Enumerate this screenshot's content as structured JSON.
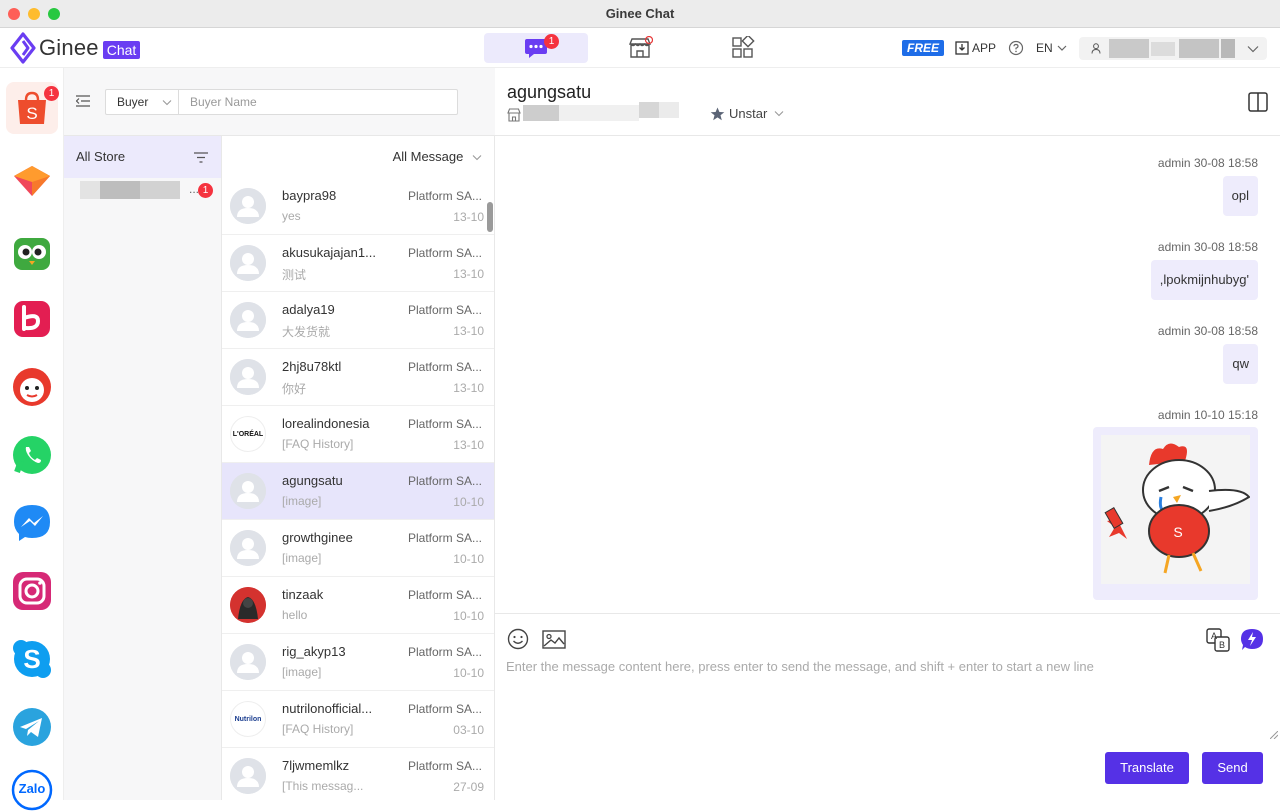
{
  "window": {
    "title": "Ginee Chat"
  },
  "brand": {
    "name": "Ginee",
    "badge": "Chat",
    "accent": "#6a3df2"
  },
  "header": {
    "chat_tab_badge": "1",
    "free_label": "FREE",
    "app_label": "APP",
    "lang_label": "EN"
  },
  "sidebar": {
    "apps": [
      {
        "name": "shopee",
        "badge": "1",
        "color": "#ee4d2d"
      },
      {
        "name": "lazada",
        "color": "#f0475b"
      },
      {
        "name": "tokopedia",
        "color": "#3fa93f"
      },
      {
        "name": "bukalapak",
        "color": "#e31e52"
      },
      {
        "name": "bot",
        "color": "#e8392c"
      },
      {
        "name": "whatsapp",
        "color": "#25d366"
      },
      {
        "name": "messenger",
        "color": "#1f8af5"
      },
      {
        "name": "instagram",
        "color": "#d62976"
      },
      {
        "name": "skype",
        "color": "#0e9ef0"
      },
      {
        "name": "telegram",
        "color": "#2aa3de"
      },
      {
        "name": "zalo",
        "label": "Zalo",
        "color": "#0068ff"
      }
    ]
  },
  "search": {
    "type_label": "Buyer",
    "placeholder": "Buyer Name"
  },
  "stores": {
    "all_label": "All Store",
    "store_badge": "1",
    "store_ellipsis": "..."
  },
  "conversations": {
    "filter_label": "All Message",
    "items": [
      {
        "name": "baypra98",
        "preview": "yes",
        "platform": "Platform SA...",
        "date": "13-10",
        "avatar": "default"
      },
      {
        "name": "akusukajajan1...",
        "preview": "测试",
        "platform": "Platform SA...",
        "date": "13-10",
        "avatar": "default"
      },
      {
        "name": "adalya19",
        "preview": "大发货就",
        "platform": "Platform SA...",
        "date": "13-10",
        "avatar": "default"
      },
      {
        "name": "2hj8u78ktl",
        "preview": "你好",
        "platform": "Platform SA...",
        "date": "13-10",
        "avatar": "default"
      },
      {
        "name": "lorealindonesia",
        "preview": "[FAQ History]",
        "platform": "Platform SA...",
        "date": "13-10",
        "avatar": "loreal",
        "avatar_text": "L'ORÉAL"
      },
      {
        "name": "agungsatu",
        "preview": "[image]",
        "platform": "Platform SA...",
        "date": "10-10",
        "avatar": "default",
        "selected": true
      },
      {
        "name": "growthginee",
        "preview": "[image]",
        "platform": "Platform SA...",
        "date": "10-10",
        "avatar": "default"
      },
      {
        "name": "tinzaak",
        "preview": "hello",
        "platform": "Platform SA...",
        "date": "10-10",
        "avatar": "photo"
      },
      {
        "name": "rig_akyp13",
        "preview": "[image]",
        "platform": "Platform SA...",
        "date": "10-10",
        "avatar": "default"
      },
      {
        "name": "nutrilonofficial...",
        "preview": "[FAQ History]",
        "platform": "Platform SA...",
        "date": "03-10",
        "avatar": "nutrilon",
        "avatar_text": "Nutrilon"
      },
      {
        "name": "7ljwmemlkz",
        "preview": "[This messag...",
        "platform": "Platform SA...",
        "date": "27-09",
        "avatar": "default"
      }
    ]
  },
  "chat": {
    "contact_name": "agungsatu",
    "star_label": "Unstar",
    "messages": [
      {
        "meta": "admin 30-08 18:58",
        "text": "opl"
      },
      {
        "meta": "admin 30-08 18:58",
        "text": ",lpokmijnhubyg'"
      },
      {
        "meta": "admin 30-08 18:58",
        "text": "qw"
      },
      {
        "meta": "admin 10-10 15:18",
        "type": "image",
        "image_letter": "S"
      }
    ]
  },
  "composer": {
    "placeholder": "Enter the message content here, press enter to send the message, and shift + enter to start a new line",
    "translate_label": "Translate",
    "send_label": "Send"
  }
}
